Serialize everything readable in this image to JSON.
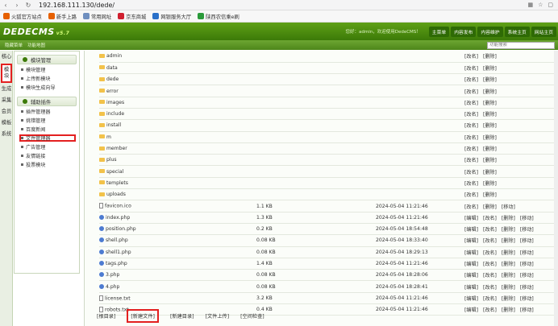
{
  "browser": {
    "url": "192.168.111.130/dede/"
  },
  "bookmarks": [
    {
      "label": "火狐官方站点",
      "color": "#e66000"
    },
    {
      "label": "新手上路",
      "color": "#e66000"
    },
    {
      "label": "常用网址",
      "color": "#6f8fbf"
    },
    {
      "label": "京东商城",
      "color": "#d01f2f"
    },
    {
      "label": "网银服务大厅",
      "color": "#2a70c9"
    },
    {
      "label": "陕西农信乘e刷",
      "color": "#2a9a3a"
    }
  ],
  "header": {
    "logo": "DEDECMS",
    "version": "v5.7",
    "welcome": "您好：admin，欢迎使用DedeCMS！",
    "nav": [
      "主菜单",
      "内容发布",
      "内容维护",
      "系统主页",
      "网站主页"
    ]
  },
  "subbar": {
    "hide_menu": "隐藏菜单",
    "shortcut": "功能地图",
    "search_placeholder": "功能搜索"
  },
  "vtabs": [
    {
      "label": "核心",
      "selected": false
    },
    {
      "label": "模块",
      "selected": true
    },
    {
      "label": "生成",
      "selected": false
    },
    {
      "label": "采集",
      "selected": false
    },
    {
      "label": "会员",
      "selected": false
    },
    {
      "label": "模板",
      "selected": false
    },
    {
      "label": "系统",
      "selected": false
    }
  ],
  "sidebar": {
    "sections": [
      {
        "title": "模块管理",
        "items": [
          {
            "label": "模块管理",
            "highlight": false
          },
          {
            "label": "上传新模块",
            "highlight": false
          },
          {
            "label": "模块生成向导",
            "highlight": false
          }
        ]
      },
      {
        "title": "辅助插件",
        "items": [
          {
            "label": "插件管理器",
            "highlight": false
          },
          {
            "label": "挑错管理",
            "highlight": false
          },
          {
            "label": "百度新闻",
            "highlight": false
          },
          {
            "label": "文件管理器",
            "highlight": true
          },
          {
            "label": "广告管理",
            "highlight": false
          },
          {
            "label": "友情链接",
            "highlight": false
          },
          {
            "label": "投票模块",
            "highlight": false
          }
        ]
      }
    ]
  },
  "files": {
    "folders": [
      {
        "name": "admin",
        "actions": [
          "[改名]",
          "[删除]"
        ]
      },
      {
        "name": "data",
        "actions": [
          "[改名]",
          "[删除]"
        ]
      },
      {
        "name": "dede",
        "actions": [
          "[改名]",
          "[删除]"
        ]
      },
      {
        "name": "error",
        "actions": [
          "[改名]",
          "[删除]"
        ]
      },
      {
        "name": "images",
        "actions": [
          "[改名]",
          "[删除]"
        ]
      },
      {
        "name": "include",
        "actions": [
          "[改名]",
          "[删除]"
        ]
      },
      {
        "name": "install",
        "actions": [
          "[改名]",
          "[删除]"
        ]
      },
      {
        "name": "m",
        "actions": [
          "[改名]",
          "[删除]"
        ]
      },
      {
        "name": "member",
        "actions": [
          "[改名]",
          "[删除]"
        ]
      },
      {
        "name": "plus",
        "actions": [
          "[改名]",
          "[删除]"
        ]
      },
      {
        "name": "special",
        "actions": [
          "[改名]",
          "[删除]"
        ]
      },
      {
        "name": "templets",
        "actions": [
          "[改名]",
          "[删除]"
        ]
      },
      {
        "name": "uploads",
        "actions": [
          "[改名]",
          "[删除]"
        ]
      }
    ],
    "files": [
      {
        "name": "favicon.ico",
        "icon": "doc",
        "size": "1.1 KB",
        "time": "2024-05-04 11:21:46",
        "actions": [
          "[改名]",
          "[删除]",
          "[移动]"
        ]
      },
      {
        "name": "index.php",
        "icon": "php",
        "size": "1.3 KB",
        "time": "2024-05-04 11:21:46",
        "actions": [
          "[编辑]",
          "[改名]",
          "[删除]",
          "[移动]"
        ]
      },
      {
        "name": "position.php",
        "icon": "php",
        "size": "0.2 KB",
        "time": "2024-05-04 18:54:48",
        "actions": [
          "[编辑]",
          "[改名]",
          "[删除]",
          "[移动]"
        ]
      },
      {
        "name": "shell.php",
        "icon": "php",
        "size": "0.08 KB",
        "time": "2024-05-04 18:33:40",
        "actions": [
          "[编辑]",
          "[改名]",
          "[删除]",
          "[移动]"
        ]
      },
      {
        "name": "shell1.php",
        "icon": "php",
        "size": "0.08 KB",
        "time": "2024-05-04 18:29:13",
        "actions": [
          "[编辑]",
          "[改名]",
          "[删除]",
          "[移动]"
        ]
      },
      {
        "name": "tags.php",
        "icon": "php",
        "size": "1.4 KB",
        "time": "2024-05-04 11:21:46",
        "actions": [
          "[编辑]",
          "[改名]",
          "[删除]",
          "[移动]"
        ]
      },
      {
        "name": "3.php",
        "icon": "php",
        "size": "0.08 KB",
        "time": "2024-05-04 18:28:06",
        "actions": [
          "[编辑]",
          "[改名]",
          "[删除]",
          "[移动]"
        ]
      },
      {
        "name": "4.php",
        "icon": "php",
        "size": "0.08 KB",
        "time": "2024-05-04 18:28:41",
        "actions": [
          "[编辑]",
          "[改名]",
          "[删除]",
          "[移动]"
        ]
      },
      {
        "name": "license.txt",
        "icon": "doc",
        "size": "3.2 KB",
        "time": "2024-05-04 11:21:46",
        "actions": [
          "[编辑]",
          "[改名]",
          "[删除]",
          "[移动]"
        ]
      },
      {
        "name": "robots.txt",
        "icon": "doc",
        "size": "0.4 KB",
        "time": "2024-05-04 11:21:46",
        "actions": [
          "[编辑]",
          "[改名]",
          "[删除]",
          "[移动]"
        ]
      }
    ]
  },
  "bottom": [
    {
      "label": "[根目录]",
      "highlight": false
    },
    {
      "label": "[新建文件]",
      "highlight": true
    },
    {
      "label": "[新建目录]",
      "highlight": false
    },
    {
      "label": "[文件上传]",
      "highlight": false
    },
    {
      "label": "[空间检查]",
      "highlight": false
    }
  ]
}
